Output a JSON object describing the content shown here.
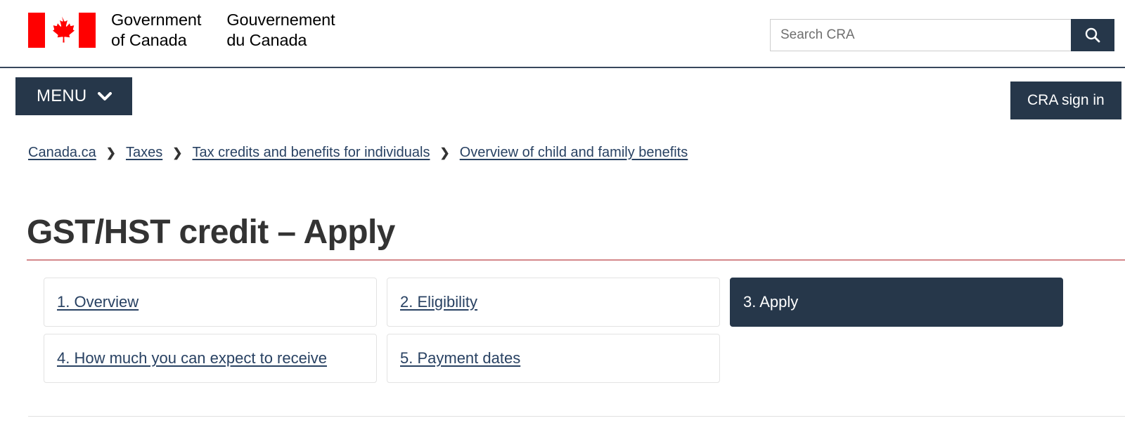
{
  "header": {
    "flag_icon": "canada-flag-icon",
    "wordmark_en": [
      "Government",
      "of Canada"
    ],
    "wordmark_fr": [
      "Gouvernement",
      "du Canada"
    ],
    "search": {
      "placeholder": "Search CRA",
      "value": "",
      "button_icon": "search-icon"
    }
  },
  "menu": {
    "label": "MENU",
    "chevron_icon": "chevron-down-icon",
    "signin_label": "CRA sign in"
  },
  "breadcrumb": {
    "separator": "❯",
    "items": [
      {
        "label": "Canada.ca"
      },
      {
        "label": "Taxes"
      },
      {
        "label": "Tax credits and benefits for individuals"
      },
      {
        "label": "Overview of child and family benefits"
      }
    ]
  },
  "main": {
    "title": "GST/HST credit – Apply",
    "tabs": [
      {
        "label": "1. Overview",
        "active": false
      },
      {
        "label": "2. Eligibility",
        "active": false
      },
      {
        "label": "3. Apply",
        "active": true
      },
      {
        "label": "4. How much you can expect to receive",
        "active": false
      },
      {
        "label": "5. Payment dates",
        "active": false
      }
    ]
  },
  "colors": {
    "navy": "#26374a",
    "link": "#284162",
    "flag_red": "#ff0000",
    "title_rule": "#d4888b",
    "header_rule": "#38485c"
  }
}
